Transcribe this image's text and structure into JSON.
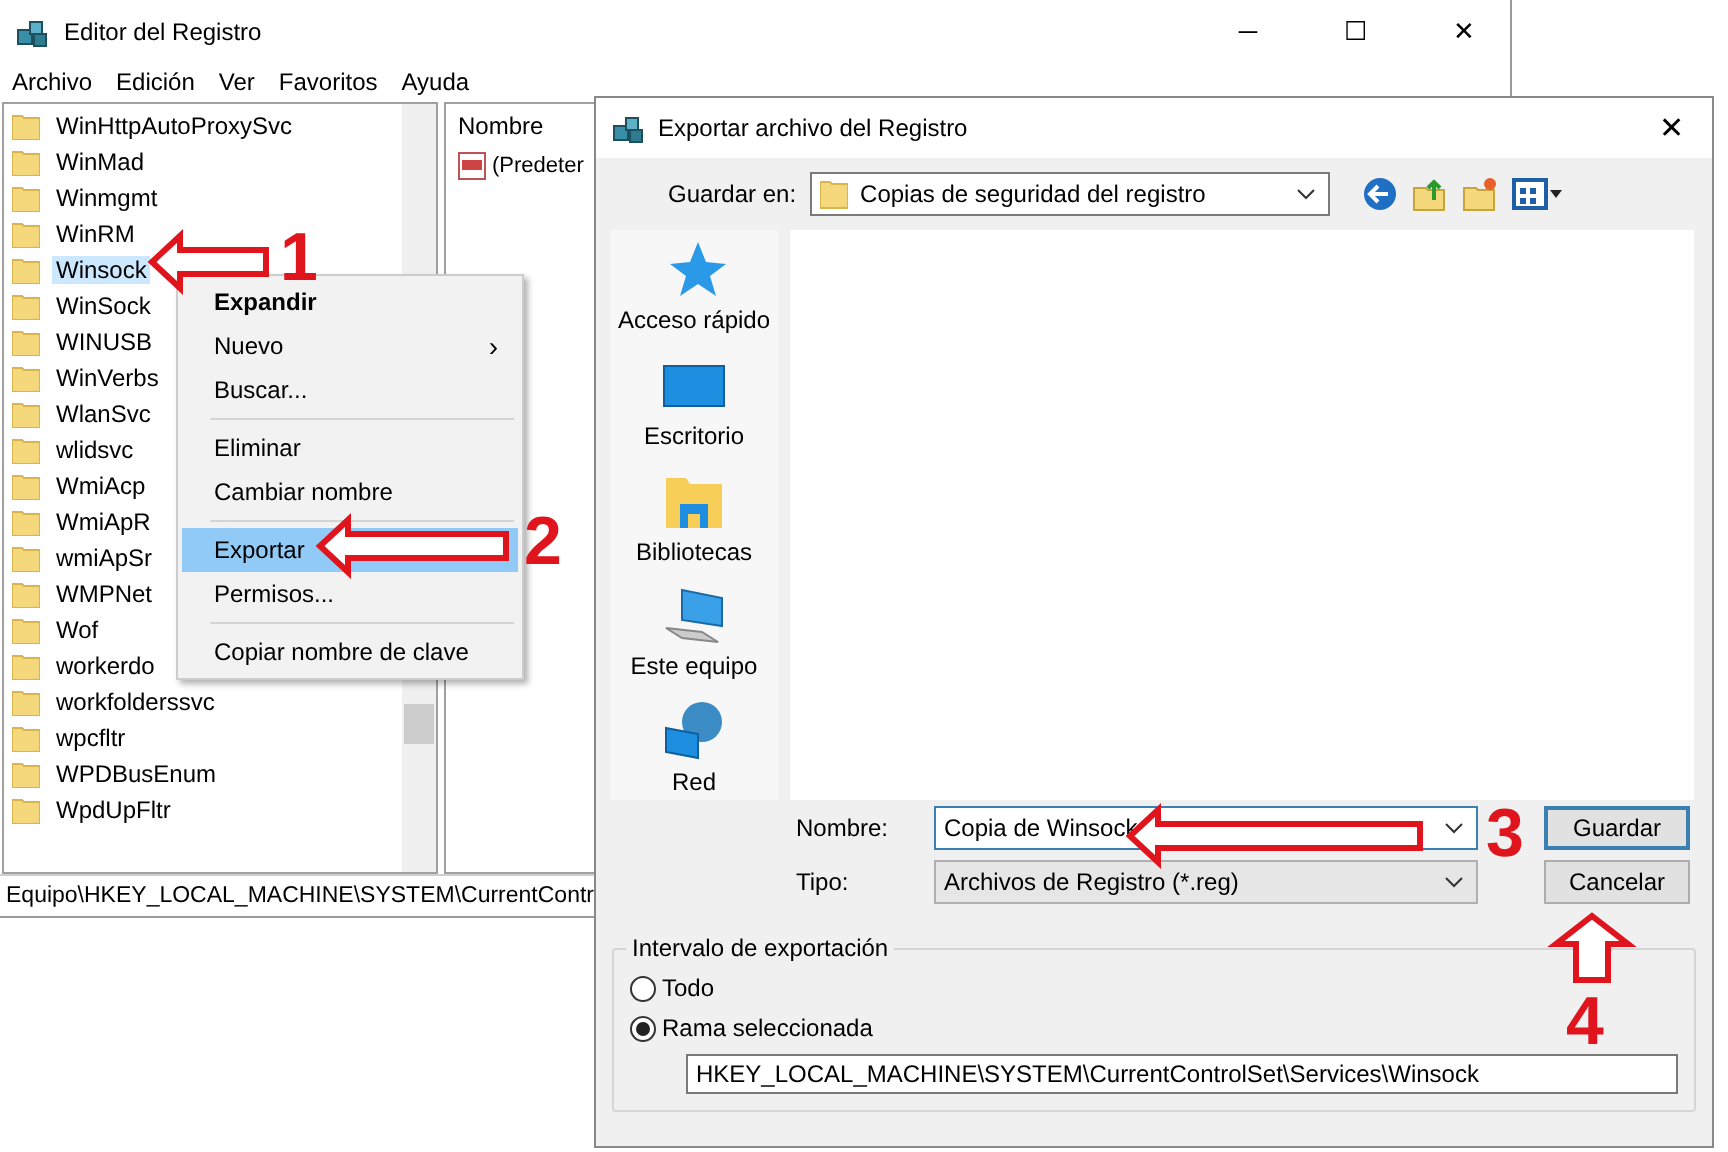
{
  "window": {
    "title": "Editor del Registro",
    "controls": [
      "─",
      "☐",
      "✕"
    ]
  },
  "menu_bar": [
    "Archivo",
    "Edición",
    "Ver",
    "Favoritos",
    "Ayuda"
  ],
  "tree": {
    "items": [
      {
        "label": "WinHttpAutoProxySvc",
        "selected": false
      },
      {
        "label": "WinMad",
        "selected": false
      },
      {
        "label": "Winmgmt",
        "selected": false
      },
      {
        "label": "WinRM",
        "selected": false
      },
      {
        "label": "Winsock",
        "selected": true
      },
      {
        "label": "WinSock",
        "selected": false
      },
      {
        "label": "WINUSB",
        "selected": false
      },
      {
        "label": "WinVerbs",
        "selected": false
      },
      {
        "label": "WlanSvc",
        "selected": false
      },
      {
        "label": "wlidsvc",
        "selected": false
      },
      {
        "label": "WmiAcp",
        "selected": false
      },
      {
        "label": "WmiApR",
        "selected": false
      },
      {
        "label": "wmiApSr",
        "selected": false
      },
      {
        "label": "WMPNet",
        "selected": false
      },
      {
        "label": "Wof",
        "selected": false
      },
      {
        "label": "workerdo",
        "selected": false
      },
      {
        "label": "workfolderssvc",
        "selected": false
      },
      {
        "label": "wpcfltr",
        "selected": false
      },
      {
        "label": "WPDBusEnum",
        "selected": false
      },
      {
        "label": "WpdUpFltr",
        "selected": false
      }
    ]
  },
  "values_pane": {
    "column": "Nombre",
    "rows": [
      "(Predeter"
    ]
  },
  "status_bar": "Equipo\\HKEY_LOCAL_MACHINE\\SYSTEM\\CurrentContr",
  "context_menu": {
    "groups": [
      [
        {
          "label": "Expandir",
          "default": true,
          "selected": false
        },
        {
          "label": "Nuevo",
          "default": false,
          "selected": false,
          "submenu": "›"
        },
        {
          "label": "Buscar...",
          "default": false,
          "selected": false
        }
      ],
      [
        {
          "label": "Eliminar",
          "default": false,
          "selected": false
        },
        {
          "label": "Cambiar nombre",
          "default": false,
          "selected": false
        }
      ],
      [
        {
          "label": "Exportar",
          "default": false,
          "selected": true
        },
        {
          "label": "Permisos...",
          "default": false,
          "selected": false
        }
      ],
      [
        {
          "label": "Copiar nombre de clave",
          "default": false,
          "selected": false
        }
      ]
    ]
  },
  "dialog": {
    "title": "Exportar archivo del Registro",
    "close": "✕",
    "save_in": {
      "label": "Guardar en:",
      "value": "Copias de seguridad del registro"
    },
    "places": [
      {
        "label": "Acceso rápido",
        "kind": "star"
      },
      {
        "label": "Escritorio",
        "kind": "desktop"
      },
      {
        "label": "Bibliotecas",
        "kind": "library"
      },
      {
        "label": "Este equipo",
        "kind": "computer"
      },
      {
        "label": "Red",
        "kind": "network"
      }
    ],
    "name": {
      "label": "Nombre:",
      "value": "Copia de Winsock"
    },
    "type": {
      "label": "Tipo:",
      "value": "Archivos de Registro (*.reg)"
    },
    "buttons": [
      "Guardar",
      "Cancelar"
    ],
    "export_range": {
      "title": "Intervalo de exportación",
      "options": [
        {
          "label": "Todo",
          "selected": false
        },
        {
          "label": "Rama seleccionada",
          "selected": true
        }
      ],
      "path": "HKEY_LOCAL_MACHINE\\SYSTEM\\CurrentControlSet\\Services\\Winsock"
    }
  },
  "annotations": [
    {
      "number": "1",
      "kind": "left"
    },
    {
      "number": "2",
      "kind": "left"
    },
    {
      "number": "3",
      "kind": "left"
    },
    {
      "number": "4",
      "kind": "up"
    }
  ]
}
